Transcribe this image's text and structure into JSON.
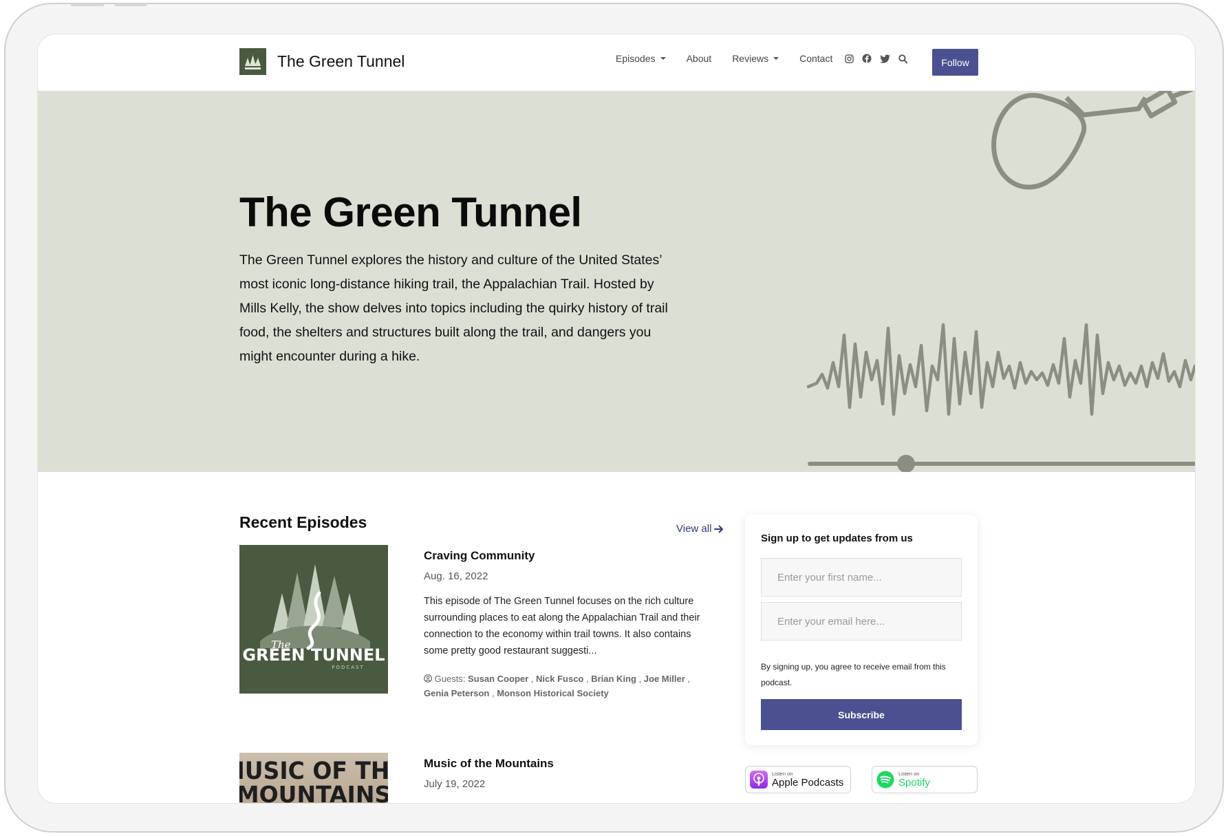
{
  "nav": {
    "brand_name": "The Green Tunnel",
    "links": [
      {
        "label": "Episodes",
        "dropdown": true
      },
      {
        "label": "About",
        "dropdown": false
      },
      {
        "label": "Reviews",
        "dropdown": true
      },
      {
        "label": "Contact",
        "dropdown": false
      }
    ],
    "follow_label": "Follow",
    "social_icons": [
      "instagram-icon",
      "facebook-icon",
      "twitter-icon",
      "search-icon"
    ]
  },
  "hero": {
    "title": "The Green Tunnel",
    "description": "The Green Tunnel explores the history and culture of the United States’ most iconic long-distance hiking trail, the Appalachian Trail. Hosted by Mills Kelly, the show delves into topics including the quirky history of trail food, the shelters and structures built along the trail, and dangers you might encounter during a hike."
  },
  "recent": {
    "title": "Recent Episodes",
    "view_all": "View all",
    "episodes": [
      {
        "title": "Craving Community",
        "date": "Aug. 16, 2022",
        "description": "This episode of The Green Tunnel focuses on the rich culture surrounding places to eat along the Appalachian Trail and their connection to the economy within trail towns. It also contains some pretty good restaurant suggesti...",
        "guests_label": "Guests:",
        "guests": [
          "Susan Cooper",
          "Nick Fusco",
          "Brian King",
          "Joe Miller",
          "Genia Peterson",
          "Monson Historical Society"
        ],
        "art_line1": "The",
        "art_line2": "GREEN TUNNEL",
        "art_line3": "PODCAST"
      },
      {
        "title": "Music of the Mountains",
        "date": "July 19, 2022",
        "art_line1": "MUSIC OF THE",
        "art_line2": "MOUNTAINS"
      }
    ]
  },
  "signup": {
    "title": "Sign up to get updates from us",
    "first_name_placeholder": "Enter your first name...",
    "email_placeholder": "Enter your email here...",
    "note": "By signing up, you agree to receive email from this podcast.",
    "subscribe_label": "Subscribe"
  },
  "badges": {
    "apple_small": "Listen on",
    "apple_big": "Apple Podcasts",
    "spotify_small": "Listen on",
    "spotify_big": "Spotify"
  },
  "colors": {
    "primary": "#4a5090",
    "hero_bg": "#dcdfd4",
    "art_green": "#4a5a40",
    "art_gray": "#8a8f82"
  }
}
